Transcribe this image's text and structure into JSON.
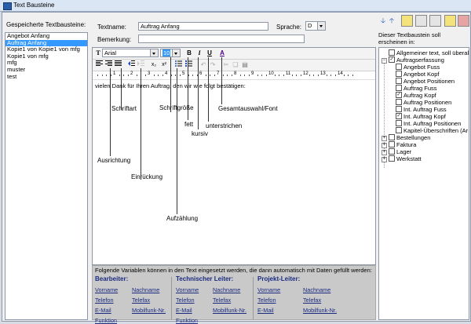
{
  "window": {
    "title": "Text Bausteine"
  },
  "left": {
    "header": "Gespeicherte Textbausteine:",
    "items": [
      {
        "label": "Angebot Anfang",
        "selected": false
      },
      {
        "label": "Auftrag Anfang",
        "selected": true
      },
      {
        "label": "Kopie1 von Kopie1 von mfg",
        "selected": false
      },
      {
        "label": "Kopie1 von mfg",
        "selected": false
      },
      {
        "label": "mfg",
        "selected": false
      },
      {
        "label": "muster",
        "selected": false
      },
      {
        "label": "test",
        "selected": false
      }
    ]
  },
  "form": {
    "textname_label": "Textname:",
    "textname_value": "Auftrag Anfang",
    "sprache_label": "Sprache:",
    "sprache_value": "D",
    "bemerkung_label": "Bemerkung:",
    "bemerkung_value": ""
  },
  "toolbar": {
    "font_icon": "T",
    "font_value": "Arial",
    "size_value": "10",
    "bold": "B",
    "italic": "I",
    "underline": "U",
    "fontcolor": "A",
    "subscript": "x₂",
    "superscript": "x²"
  },
  "editor": {
    "text": "vielen Dank für Ihren Auftrag, den wir wie folgt bestätigen:",
    "ruler_numbers": [
      "1",
      "2",
      "3",
      "4",
      "5",
      "6",
      "7",
      "8",
      "9",
      "10",
      "11",
      "12",
      "13",
      "14",
      "15"
    ]
  },
  "annotations": {
    "schriftart": "Schriftart",
    "schriftgroesse": "Schriftgröße",
    "fett": "fett",
    "kursiv": "kursiv",
    "unterstrichen": "unterstrichen",
    "gesamtauswahl": "Gesamtauswahl/Font",
    "ausrichtung": "Ausrichtung",
    "einrueckung": "Einrückung",
    "aufzaehlung": "Aufzählung"
  },
  "variables": {
    "header": "Folgende Variablen können in den Text eingesetzt werden, die dann automatisch mit Daten gefüllt werden:",
    "groups": [
      {
        "title": "Bearbeiter:",
        "links": [
          "Vorname",
          "Nachname",
          "Telefon",
          "Telefax",
          "E-Mail",
          "Mobilfunk-Nr.",
          "Funktion"
        ]
      },
      {
        "title": "Technischer Leiter:",
        "links": [
          "Vorname",
          "Nachname",
          "Telefon",
          "Telefax",
          "E-Mail",
          "Mobilfunk-Nr.",
          "Funktion"
        ]
      },
      {
        "title": "Projekt-Leiter:",
        "links": [
          "Vorname",
          "Nachname",
          "Telefon",
          "Telefax",
          "E-Mail",
          "Mobilfunk-Nr."
        ]
      }
    ]
  },
  "right": {
    "desc_line1": "Dieser Textbaustein soll",
    "desc_line2": "erscheinen in:",
    "tree": [
      {
        "label": "Allgemeiner text, soll überal",
        "checked": false
      },
      {
        "label": "Auftragserfassung",
        "checked": true
      },
      {
        "label": "Angebot Fuss",
        "checked": false
      },
      {
        "label": "Angebot Kopf",
        "checked": false
      },
      {
        "label": "Angebot Positionen",
        "checked": false
      },
      {
        "label": "Auftrag Fuss",
        "checked": false
      },
      {
        "label": "Auftrag Kopf",
        "checked": true
      },
      {
        "label": "Auftrag Positionen",
        "checked": false
      },
      {
        "label": "Int. Auftrag Fuss",
        "checked": false
      },
      {
        "label": "Int. Auftrag Kopf",
        "checked": true
      },
      {
        "label": "Int. Auftrag Positionen",
        "checked": false
      },
      {
        "label": "Kapitel-Überschriften (Ar",
        "checked": false
      },
      {
        "label": "Bestellungen",
        "checked": false
      },
      {
        "label": "Faktura",
        "checked": false
      },
      {
        "label": "Lager",
        "checked": false
      },
      {
        "label": "Werkstatt",
        "checked": false
      }
    ]
  },
  "colors": {
    "selection": "#3399ff",
    "link": "#1b2b80",
    "arrow": "#1f4fb8"
  }
}
